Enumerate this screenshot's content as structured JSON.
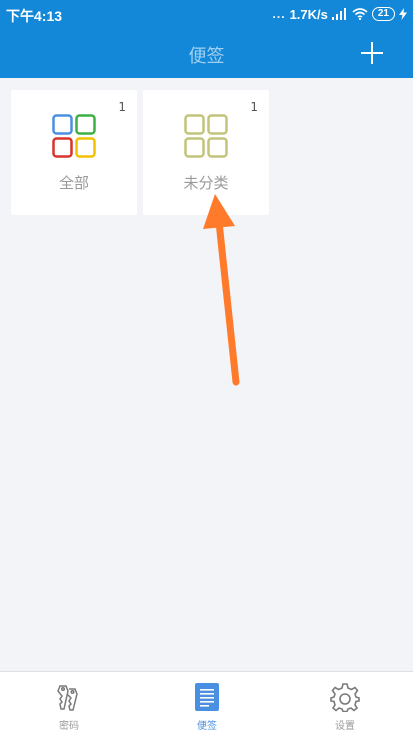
{
  "status_bar": {
    "time": "下午4:13",
    "network_speed": "1.7K/s",
    "dots": "...",
    "battery": "21"
  },
  "app_bar": {
    "title": "便签"
  },
  "categories": [
    {
      "label": "全部",
      "count": "1"
    },
    {
      "label": "未分类",
      "count": "1"
    }
  ],
  "bottom_nav": {
    "items": [
      {
        "label": "密码",
        "icon": "keys-icon",
        "active": false
      },
      {
        "label": "便签",
        "icon": "note-icon",
        "active": true
      },
      {
        "label": "设置",
        "icon": "gear-icon",
        "active": false
      }
    ]
  },
  "colors": {
    "primary": "#1488d8",
    "annotation_arrow": "#ff7a2a",
    "all_icon_blue": "#4a90e2",
    "all_icon_green": "#3cb043",
    "all_icon_red": "#d9342b",
    "all_icon_yellow": "#f2c200",
    "uncategorized_icon": "#c2c47a",
    "active_tab": "#4a90e2"
  }
}
